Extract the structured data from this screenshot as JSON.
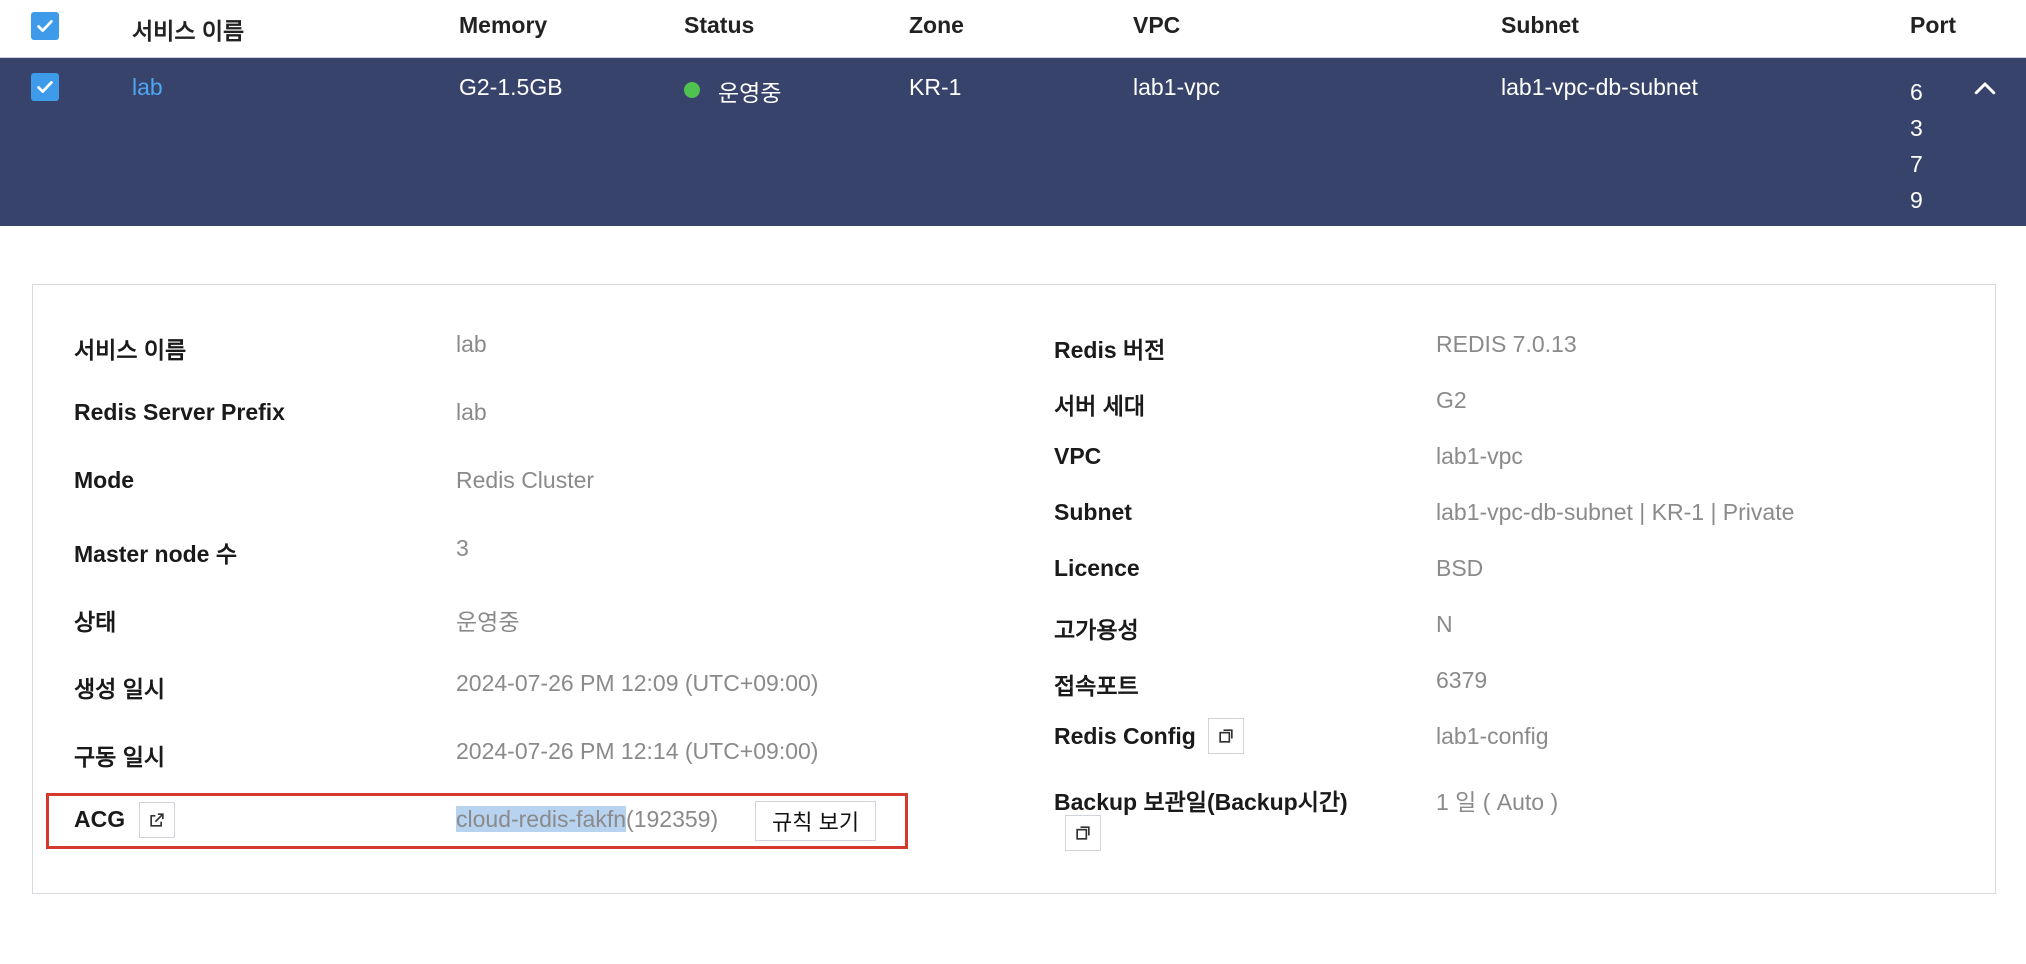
{
  "table": {
    "headers": {
      "service_name": "서비스 이름",
      "memory": "Memory",
      "status": "Status",
      "zone": "Zone",
      "vpc": "VPC",
      "subnet": "Subnet",
      "port": "Port"
    },
    "row": {
      "service_name": "lab",
      "memory": "G2-1.5GB",
      "status": "운영중",
      "zone": "KR-1",
      "vpc": "lab1-vpc",
      "subnet": "lab1-vpc-db-subnet",
      "port_lines": [
        "6",
        "3",
        "7",
        "9"
      ]
    }
  },
  "details": {
    "left": {
      "service_name_label": "서비스 이름",
      "service_name_value": "lab",
      "prefix_label": "Redis Server Prefix",
      "prefix_value": "lab",
      "mode_label": "Mode",
      "mode_value": "Redis Cluster",
      "master_label": "Master node 수",
      "master_value": "3",
      "state_label": "상태",
      "state_value": "운영중",
      "created_label": "생성 일시",
      "created_value": "2024-07-26 PM 12:09 (UTC+09:00)",
      "started_label": "구동 일시",
      "started_value": "2024-07-26 PM 12:14 (UTC+09:00)",
      "acg_label": "ACG",
      "acg_name": "cloud-redis-fakfn",
      "acg_id": "(192359)",
      "rule_button": "규칙 보기"
    },
    "right": {
      "version_label": "Redis 버전",
      "version_value": "REDIS 7.0.13",
      "gen_label": "서버 세대",
      "gen_value": "G2",
      "vpc_label": "VPC",
      "vpc_value": "lab1-vpc",
      "subnet_label": "Subnet",
      "subnet_value": "lab1-vpc-db-subnet | KR-1 | Private",
      "licence_label": "Licence",
      "licence_value": "BSD",
      "ha_label": "고가용성",
      "ha_value": "N",
      "port_label": "접속포트",
      "port_value": "6379",
      "config_label": "Redis Config",
      "config_value": "lab1-config",
      "backup_label": "Backup 보관일(Backup시간)",
      "backup_value": "1 일 ( Auto )"
    }
  },
  "colors": {
    "selected_row_bg": "#37436b",
    "link": "#4ea6f2",
    "status_running": "#4fc24f",
    "checkbox": "#3d9be9",
    "highlight_box": "#d33a2c",
    "text_selection": "#b8d3f0"
  },
  "icons": {
    "checkbox": "check-icon",
    "collapse": "chevron-up-icon",
    "external": "external-link-icon",
    "copy": "copy-icon"
  }
}
